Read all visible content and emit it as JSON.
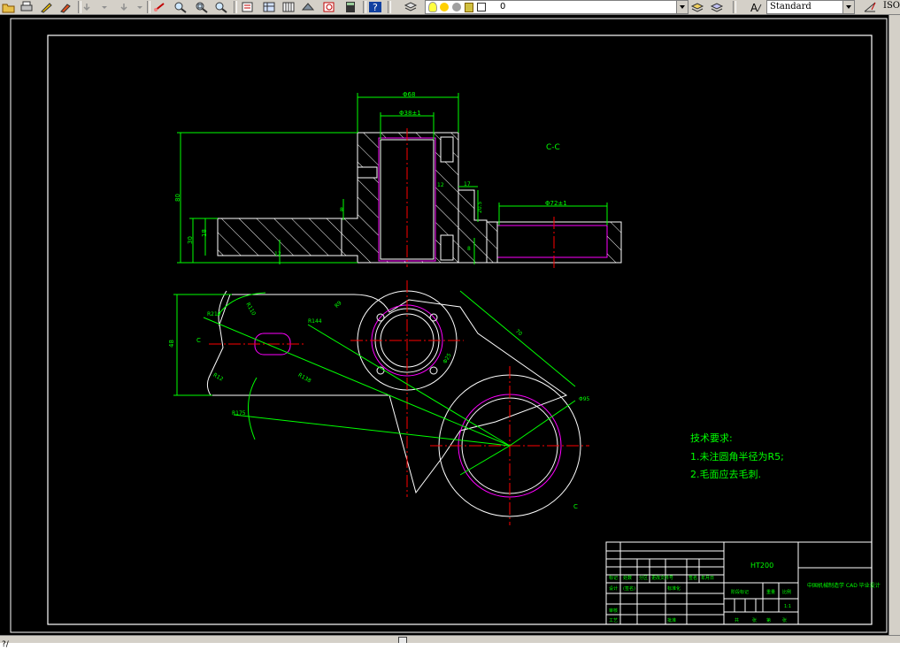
{
  "toolbar": {
    "layer_value": "0",
    "text_style": "Standard",
    "dim_style": "ISO",
    "icons": [
      "open-icon",
      "print-icon",
      "pencil-icon",
      "brush-icon",
      "undo-icon",
      "redo-icon",
      "pan-icon",
      "zoom-realtime-icon",
      "zoom-window-icon",
      "zoom-previous-icon",
      "properties-icon",
      "design-center-icon",
      "tool-palettes-icon",
      "markup-icon",
      "calculator-icon",
      "help-icon",
      "layer-manager-icon",
      "layer-state-icons",
      "text-style-icon",
      "dim-style-icon"
    ]
  },
  "drawing": {
    "section_label": "C-C",
    "dims": {
      "top_width": "Φ68",
      "bore": "Φ38±1",
      "height_total": "80",
      "arm_thickness": "30",
      "arm_inner": "18",
      "small_h": "8",
      "slot_w": "12",
      "step": "17",
      "right_bore": "Φ72±1",
      "right_h": "20.5",
      "right_small": "8",
      "bottom_small": "12",
      "left_height": "48",
      "r210": "R210",
      "r110": "R110",
      "r144": "R144",
      "r175": "R175",
      "r138": "R138",
      "r12": "R12",
      "r9": "R9",
      "small_view": "Φ25",
      "long_dim": "70",
      "d95": "Φ95",
      "cut_mark": "C",
      "cut_mark2": "C"
    }
  },
  "tech_requirements": {
    "title": "技术要求:",
    "line1": "1.未注圆角半径为R5;",
    "line2": "2.毛面应去毛刺."
  },
  "title_block": {
    "material": "HT200",
    "drawing_name": "中国机械制造学 CAD 毕业设计",
    "cells": [
      "标记",
      "处数",
      "分区",
      "更改文件号",
      "签名",
      "年月日",
      "设计",
      "(签名)",
      "标准化",
      "阶段标记",
      "重量",
      "比例",
      "审核",
      "工艺",
      "批准",
      "1:1",
      "共",
      "张",
      "第",
      "张"
    ]
  },
  "colors": {
    "outline": "#ffffff",
    "dimension": "#00ff00",
    "centerline": "#ff0000",
    "hidden": "#ff00ff",
    "hatch": "#ffffff",
    "tech_text": "#00ff00"
  },
  "command_line": "?/"
}
